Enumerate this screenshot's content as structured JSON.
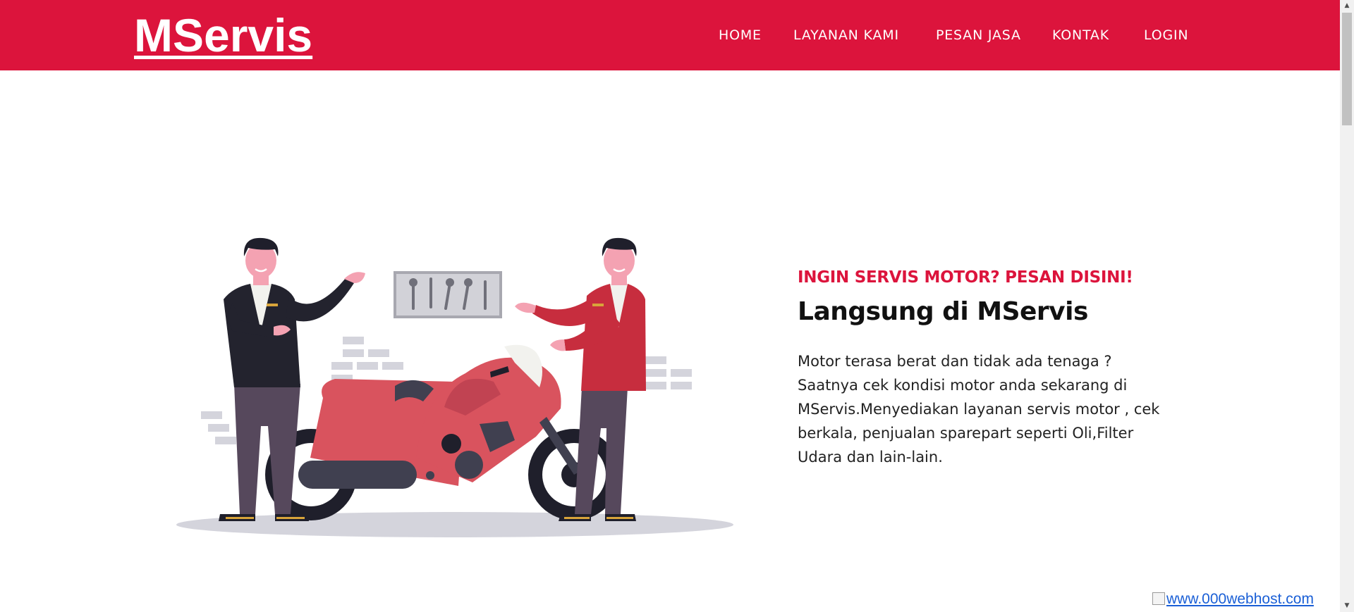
{
  "brand": {
    "name": "MServis"
  },
  "nav": {
    "items": [
      {
        "label": "HOME"
      },
      {
        "label": "LAYANAN KAMI"
      },
      {
        "label": "PESAN JASA"
      },
      {
        "label": "KONTAK"
      },
      {
        "label": "LOGIN"
      }
    ]
  },
  "hero": {
    "tagline": "INGIN SERVIS MOTOR? PESAN DISINI!",
    "headline": "Langsung di MServis",
    "description": "Motor terasa berat dan tidak ada tenaga ? Saatnya cek kondisi motor anda sekarang di MServis.Menyediakan layanan servis motor , cek berkala, penjualan sparepart seperti Oli,Filter Udara dan lain-lain."
  },
  "footer": {
    "badge_link": "www.000webhost.com"
  },
  "colors": {
    "brand_red": "#dc143c",
    "motorcycle_red": "#d9535e",
    "mechanic_shirt_red": "#c72d3e",
    "mechanic_shirt_dark": "#23232e",
    "tire_dark": "#1f1f2b",
    "link_blue": "#1a5fd6"
  },
  "icons": {
    "hero_illustration": "mechanics-with-motorcycle-illustration",
    "tool_board": "wrench-tools-board-icon",
    "broken_image": "broken-image-icon"
  }
}
